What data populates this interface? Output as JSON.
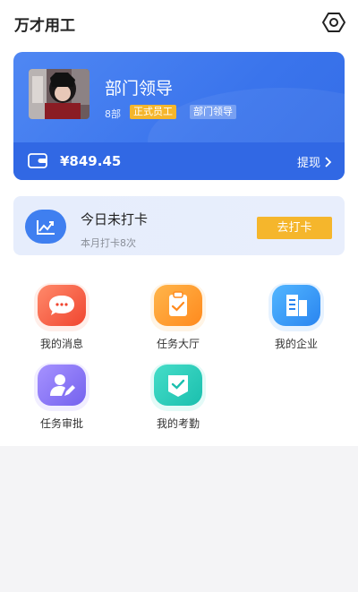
{
  "header": {
    "title": "万才用工",
    "settings_icon": "settings-hexagon-icon"
  },
  "profile": {
    "name": "部门领导",
    "department": "8部",
    "employee_tag": "正式员工",
    "role_tag": "部门领导",
    "avatar": "anime-avatar-image"
  },
  "wallet": {
    "icon": "wallet-icon",
    "balance": "¥849.45",
    "withdraw_label": "提现"
  },
  "checkin": {
    "title": "今日未打卡",
    "subtitle": "本月打卡8次",
    "button_label": "去打卡",
    "icon": "trend-chart-icon"
  },
  "menu": [
    {
      "label": "我的消息",
      "icon": "message-icon"
    },
    {
      "label": "任务大厅",
      "icon": "task-clipboard-icon"
    },
    {
      "label": "我的企业",
      "icon": "enterprise-icon"
    },
    {
      "label": "任务审批",
      "icon": "approve-user-icon"
    },
    {
      "label": "我的考勤",
      "icon": "attendance-icon"
    }
  ],
  "colors": {
    "primary_blue": "#3a74ec",
    "accent_yellow": "#f5b62c",
    "checkin_bg": "#e6edfc",
    "page_bg": "#f4f4f6"
  }
}
